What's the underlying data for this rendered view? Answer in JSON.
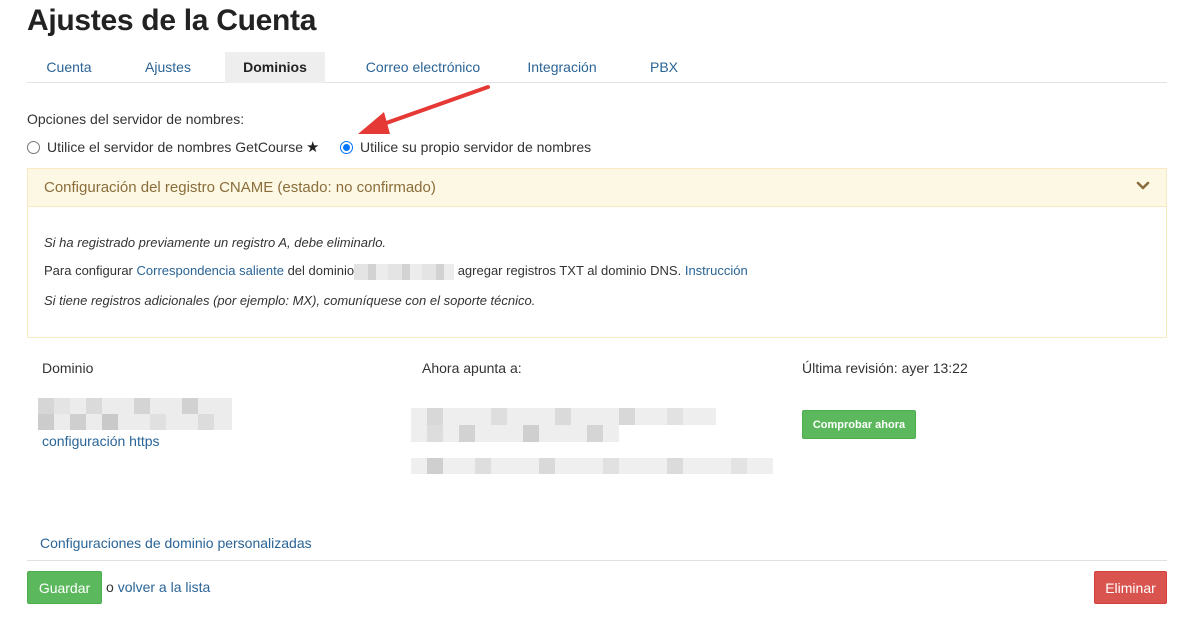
{
  "page": {
    "title": "Ajustes de la Cuenta"
  },
  "tabs": [
    {
      "label": "Cuenta",
      "active": false
    },
    {
      "label": "Ajustes",
      "active": false
    },
    {
      "label": "Dominios",
      "active": true
    },
    {
      "label": "Correo electrónico",
      "active": false
    },
    {
      "label": "Integración",
      "active": false
    },
    {
      "label": "PBX",
      "active": false
    }
  ],
  "nameserver": {
    "label": "Opciones del servidor de nombres:",
    "option_getcourse": "Utilice el servidor de nombres GetCourse",
    "option_getcourse_star": "★",
    "option_own": "Utilice su propio servidor de nombres",
    "selected": "own"
  },
  "cname_panel": {
    "title": "Configuración del registro CNAME (estado: no confirmado)",
    "line1": "Si ha registrado previamente un registro A, debe eliminarlo.",
    "line2_prefix": "Para configurar",
    "line2_link": "Correspondencia saliente",
    "line2_mid": "del dominio",
    "line2_suffix": "agregar registros TXT al dominio DNS.",
    "line2_link2": "Instrucción",
    "line3": "Si tiene registros adicionales (por ejemplo: MX), comuníquese con el soporte técnico."
  },
  "domain_table": {
    "col_domain": "Dominio",
    "col_points_to": "Ahora apunta a:",
    "col_last_check": "Última revisión: ayer 13:22",
    "https_link": "configuración https",
    "check_button": "Comprobar ahora"
  },
  "custom_settings_link": "Configuraciones de dominio personalizadas",
  "footer": {
    "save_button": "Guardar",
    "back_prefix": "o",
    "back_link": "volver a la lista",
    "delete_button": "Eliminar"
  },
  "colors": {
    "link": "#2a6496",
    "success": "#5cb85c",
    "danger": "#d9534f",
    "warning_bg": "#fcf8e3",
    "warning_text": "#8a6d3b",
    "arrow": "#e53935"
  },
  "icons": {
    "panel_toggle": "chevron-down-icon",
    "annotation": "red-arrow-icon"
  }
}
